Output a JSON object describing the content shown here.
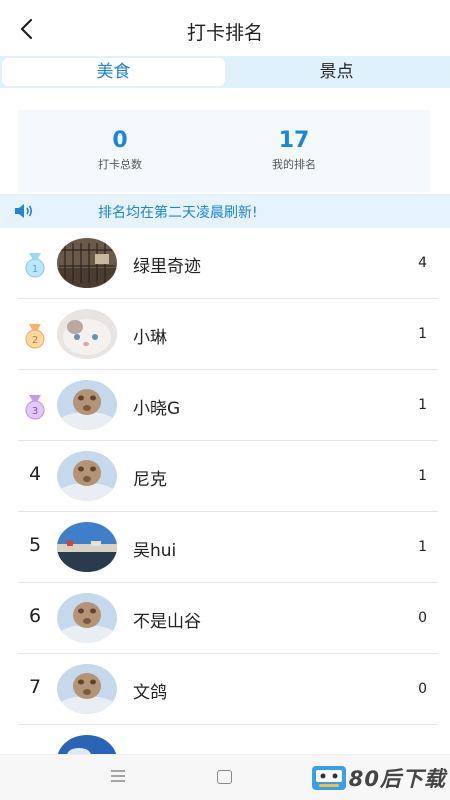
{
  "header": {
    "title": "打卡排名",
    "back_icon": "chevron-left-icon"
  },
  "tabs": [
    {
      "label": "美食",
      "active": true
    },
    {
      "label": "景点",
      "active": false
    }
  ],
  "stats": {
    "total": {
      "value": "0",
      "label": "打卡总数"
    },
    "rank": {
      "value": "17",
      "label": "我的排名"
    }
  },
  "notice": {
    "icon": "speaker-icon",
    "text": "排名均在第二天凌晨刷新!"
  },
  "ranking": [
    {
      "rank": "1",
      "medal": "silver",
      "avatar": "cage-photo",
      "name": "绿里奇迹",
      "count": "4"
    },
    {
      "rank": "2",
      "medal": "bronze",
      "avatar": "cat-photo",
      "name": "小琳",
      "count": "1"
    },
    {
      "rank": "3",
      "medal": "purple",
      "avatar": "default-avatar",
      "name": "小晓G",
      "count": "1"
    },
    {
      "rank": "4",
      "medal": null,
      "avatar": "default-avatar",
      "name": "尼克",
      "count": "1"
    },
    {
      "rank": "5",
      "medal": null,
      "avatar": "landscape-photo",
      "name": "吴hui",
      "count": "1"
    },
    {
      "rank": "6",
      "medal": null,
      "avatar": "default-avatar",
      "name": "不是山谷",
      "count": "0"
    },
    {
      "rank": "7",
      "medal": null,
      "avatar": "default-avatar",
      "name": "文鸽",
      "count": "0"
    }
  ],
  "watermark": {
    "text": "80后下载"
  },
  "colors": {
    "accent": "#1e86d4",
    "tab_bar_bg": "#dff1fb",
    "stats_bg": "#f3f9fd",
    "notice_bg": "#e6f2fc"
  }
}
